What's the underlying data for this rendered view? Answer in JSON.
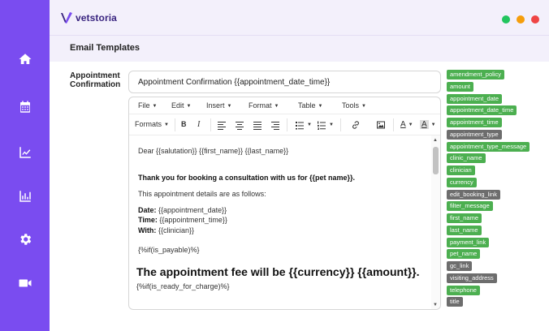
{
  "app": {
    "brand_name": "vetstoria",
    "window_dots": [
      "#22c55e",
      "#f59e0b",
      "#ef4444"
    ],
    "accent_color": "#7a4cf0"
  },
  "sidebar": {
    "items": [
      {
        "name": "home",
        "icon": "home-icon"
      },
      {
        "name": "calendar",
        "icon": "calendar-icon"
      },
      {
        "name": "trends",
        "icon": "trend-chart-icon"
      },
      {
        "name": "reports",
        "icon": "bar-chart-icon"
      },
      {
        "name": "settings",
        "icon": "gear-icon"
      },
      {
        "name": "video",
        "icon": "video-icon"
      }
    ]
  },
  "page": {
    "title": "Email Templates"
  },
  "template": {
    "label": "Appointment Confirmation",
    "subject": "Appointment Confirmation {{appointment_date_time}}"
  },
  "editor": {
    "menu": [
      "File",
      "Edit",
      "Insert",
      "Format",
      "Table",
      "Tools"
    ],
    "toolbar": {
      "formats_label": "Formats"
    },
    "body": {
      "greeting": "Dear {{salutation}} {{first_name}} {{last_name}}",
      "thanks": "Thank you for booking a consultation with us for {{pet name}}.",
      "details_intro": "This appointment details are as follows:",
      "date_label": "Date:",
      "date_value": "{{appointment_date}}",
      "time_label": "Time:",
      "time_value": "{{appointment_time}}",
      "with_label": "With:",
      "with_value": "{{clinician}}",
      "if_payable": "{%if(is_payable)%}",
      "fee_line": "The appointment fee will be {{currency}} {{amount}}.",
      "if_ready": "{%if(is_ready_for_charge)%}"
    }
  },
  "placeholders": [
    {
      "label": "amendment_policy",
      "color": "green"
    },
    {
      "label": "amount",
      "color": "green"
    },
    {
      "label": "appointment_date",
      "color": "green"
    },
    {
      "label": "appointment_date_time",
      "color": "green"
    },
    {
      "label": "appointment_time",
      "color": "green"
    },
    {
      "label": "appointment_type",
      "color": "grey"
    },
    {
      "label": "appointment_type_message",
      "color": "green"
    },
    {
      "label": "clinic_name",
      "color": "green"
    },
    {
      "label": "clinician",
      "color": "green"
    },
    {
      "label": "currency",
      "color": "green"
    },
    {
      "label": "edit_booking_link",
      "color": "grey"
    },
    {
      "label": "filter_message",
      "color": "green"
    },
    {
      "label": "first_name",
      "color": "green"
    },
    {
      "label": "last_name",
      "color": "green"
    },
    {
      "label": "payment_link",
      "color": "green"
    },
    {
      "label": "pet_name",
      "color": "green"
    },
    {
      "label": "gc_link",
      "color": "grey"
    },
    {
      "label": "visiting_address",
      "color": "grey"
    },
    {
      "label": "telephone",
      "color": "green"
    },
    {
      "label": "title",
      "color": "grey"
    }
  ]
}
